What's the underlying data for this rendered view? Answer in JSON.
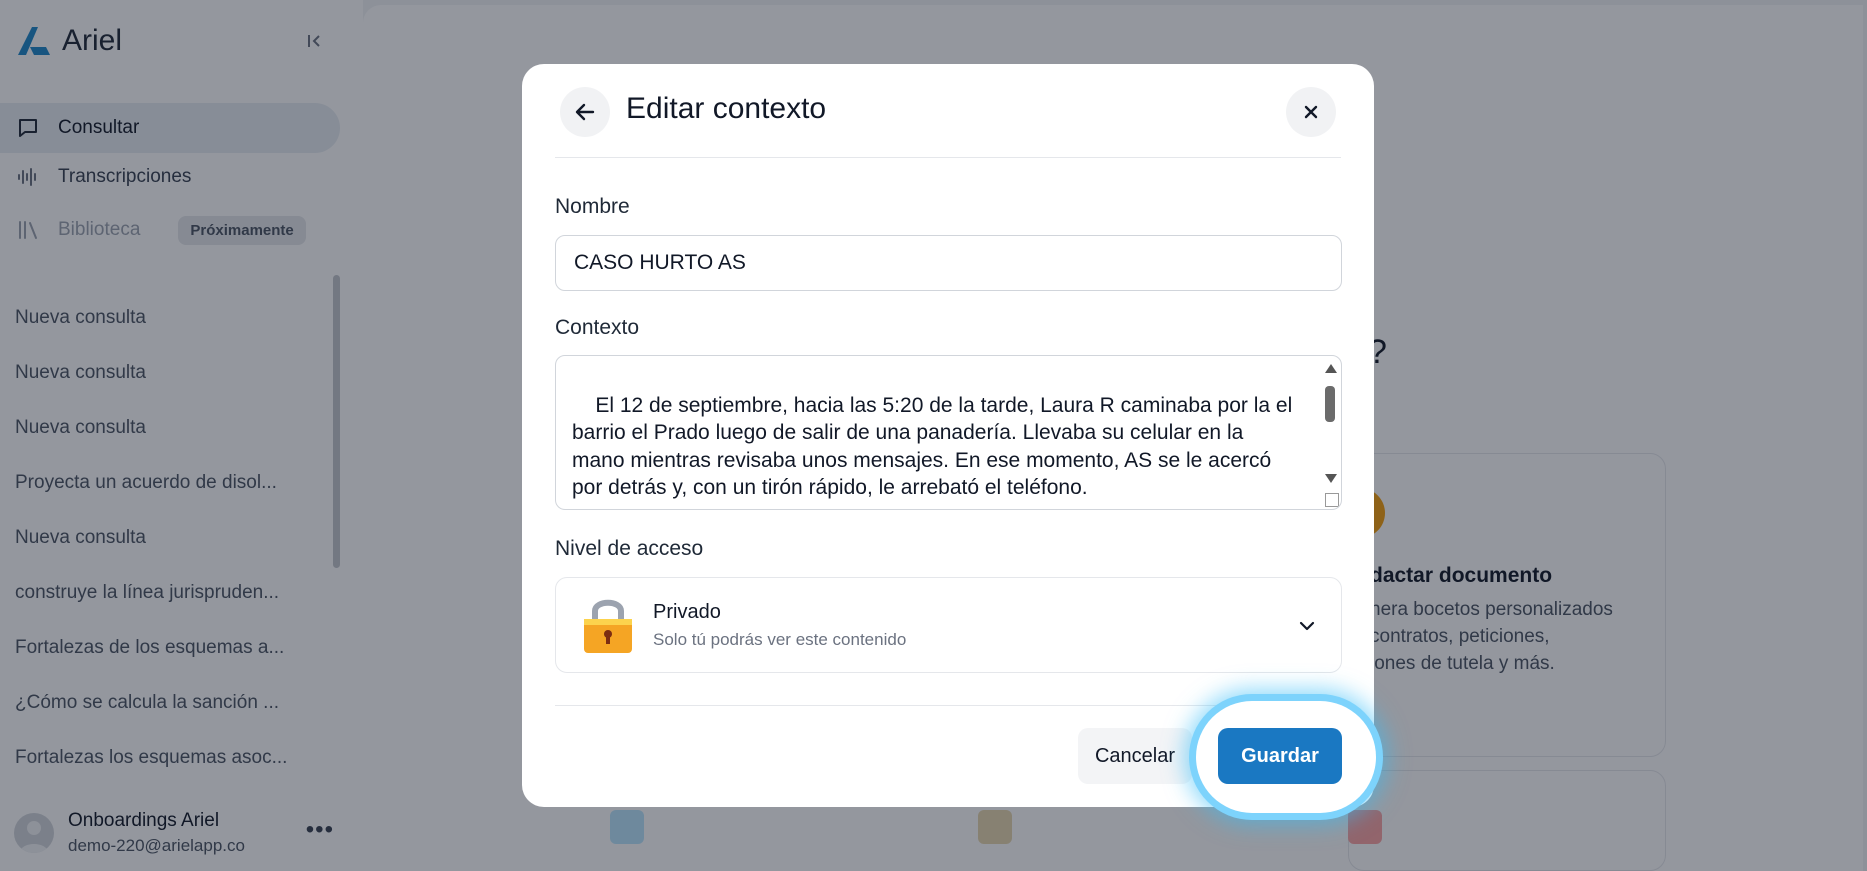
{
  "sidebar": {
    "brand": "Ariel",
    "nav": [
      {
        "label": "Consultar",
        "icon": "chat-icon"
      },
      {
        "label": "Transcripciones",
        "icon": "waveform-icon"
      },
      {
        "label": "Biblioteca",
        "icon": "library-icon",
        "badge": "Próximamente"
      }
    ],
    "history": [
      "Nueva consulta",
      "Nueva consulta",
      "Nueva consulta",
      "Proyecta un acuerdo de disol...",
      "Nueva consulta",
      "construye la línea jurispruden...",
      "Fortalezas de los esquemas a...",
      "¿Cómo se calcula la sanción ...",
      "Fortalezas los esquemas asoc..."
    ],
    "user": {
      "name": "Onboardings Ariel",
      "email": "demo-220@arielapp.co",
      "more": "•••"
    }
  },
  "background": {
    "question_mark": "?",
    "card_title": "dactar documento",
    "card_desc_1": "nera bocetos personalizados",
    "card_desc_2": "contratos, peticiones,",
    "card_desc_3": "iones de tutela y más."
  },
  "modal": {
    "title": "Editar contexto",
    "name_label": "Nombre",
    "name_value": "CASO HURTO AS",
    "context_label": "Contexto",
    "context_value": "El 12 de septiembre, hacia las 5:20 de la tarde, Laura R caminaba por la el barrio el Prado luego de salir de una panadería. Llevaba su celular en la mano mientras revisaba unos mensajes. En ese momento, AS se le acercó por detrás y, con un tirón rápido, le arrebató el teléfono.\n\nLaura intentó perseguir a AS, quién huyó por la calle lateral",
    "access_label": "Nivel de acceso",
    "access_selected": "Privado",
    "access_description": "Solo tú podrás ver este contenido",
    "cancel_label": "Cancelar",
    "save_label": "Guardar"
  },
  "colors": {
    "accent": "#1a78c2",
    "highlight": "#7dd3fc",
    "overlay": "#111827"
  }
}
